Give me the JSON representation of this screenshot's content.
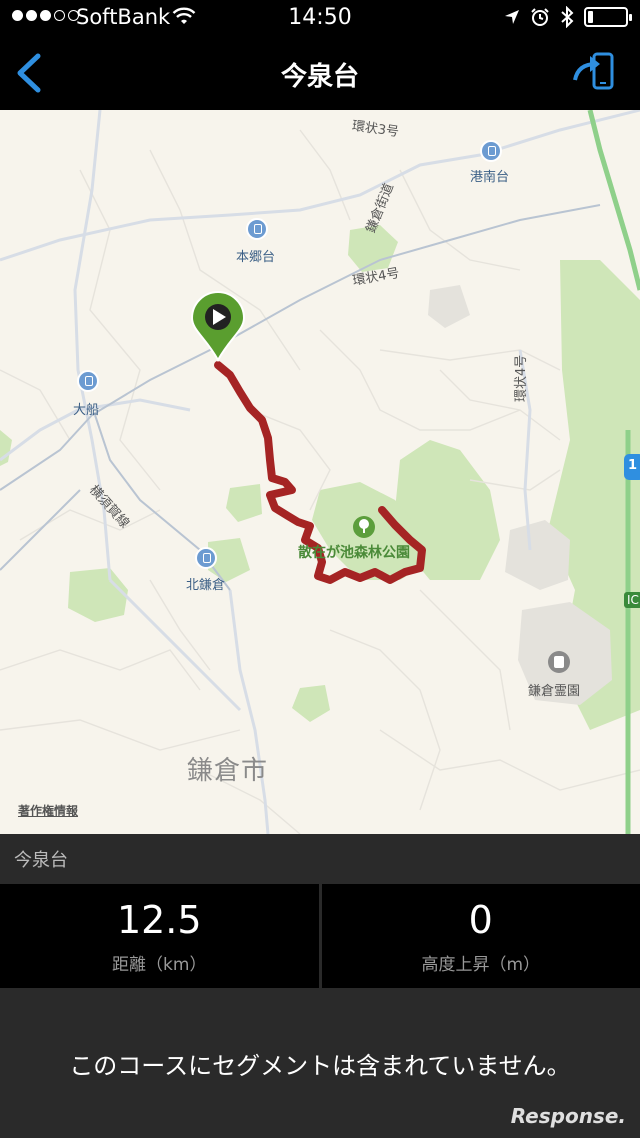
{
  "status_bar": {
    "carrier": "SoftBank",
    "time": "14:50",
    "signal_bars_filled": 3,
    "signal_bars_total": 5,
    "battery_level": 0.15
  },
  "nav": {
    "title": "今泉台",
    "back_icon": "chevron-left-icon",
    "share_icon": "send-to-device-icon",
    "accent_color": "#2f8fe0"
  },
  "map": {
    "labels": {
      "kanjo3": "環状3号",
      "konandai": "港南台",
      "kamakura_kaido": "鎌倉街道",
      "hongodai": "本郷台",
      "kanjo4": "環状4号",
      "kanjo4_vertical": "環状4号",
      "ofuna": "大船",
      "yokosuka_line": "横須賀線",
      "kitakamakura": "北鎌倉",
      "park": "散在が池森林公園",
      "reien": "鎌倉霊園",
      "city": "鎌倉市",
      "credit": "著作権情報",
      "shield_1": "1",
      "ic": "IC"
    },
    "route_color": "#a52424",
    "start_marker_color": "#5a9e2f"
  },
  "course": {
    "name": "今泉台"
  },
  "stats": {
    "distance_value": "12.5",
    "distance_label": "距離（km）",
    "elevation_value": "0",
    "elevation_label": "高度上昇（m）"
  },
  "message": "このコースにセグメントは含まれていません。",
  "watermark": "Response."
}
